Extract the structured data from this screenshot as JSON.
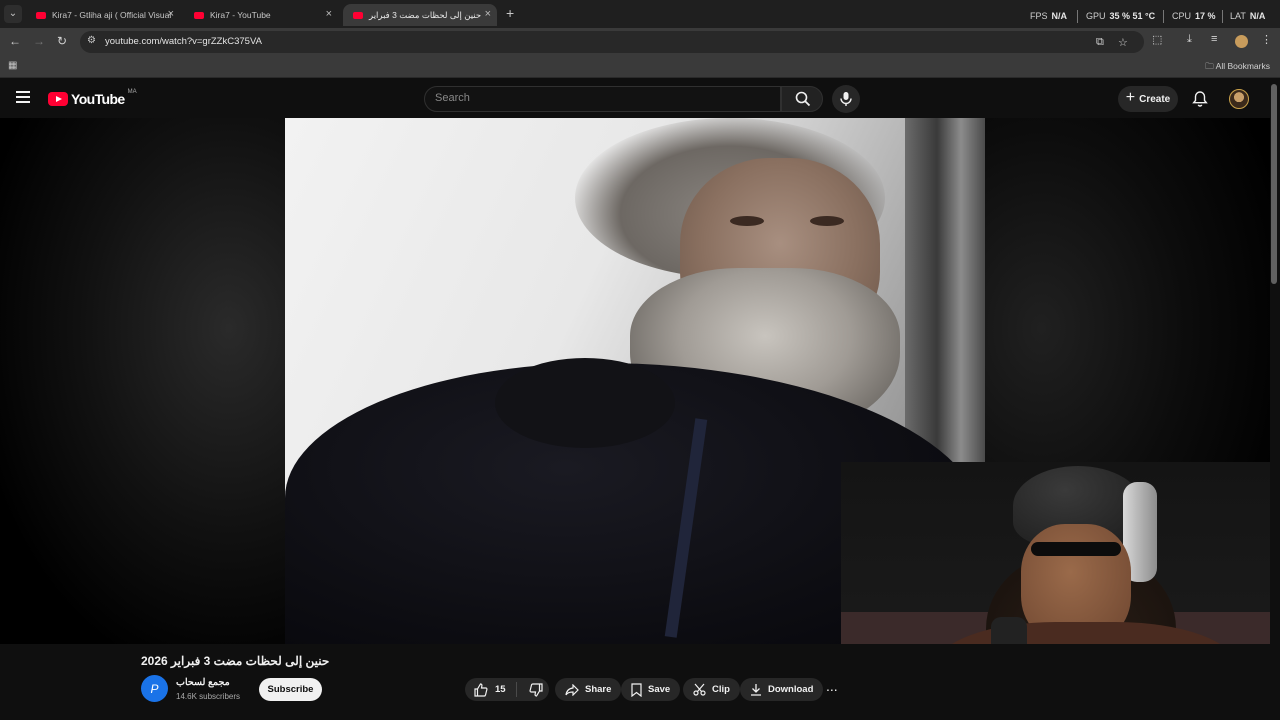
{
  "browser": {
    "tabs": [
      {
        "title": "Kira7 - Gtliha aji ( Official Visual",
        "active": false
      },
      {
        "title": "Kira7 - YouTube",
        "active": false
      },
      {
        "title": "حنين إلى لحظات مضت 3 فبراير",
        "active": true
      }
    ],
    "url": "youtube.com/watch?v=grZZkC375VA",
    "bookmarks_label": "All Bookmarks"
  },
  "overlay_stats": {
    "fps_label": "FPS",
    "fps_value": "N/A",
    "gpu_label": "GPU",
    "gpu_value": "35 % 51 °C",
    "cpu_label": "CPU",
    "cpu_value": "17 %",
    "lat_label": "LAT",
    "lat_value": "N/A"
  },
  "youtube": {
    "logo_text": "YouTube",
    "country_code": "MA",
    "search_placeholder": "Search",
    "create_label": "Create"
  },
  "video": {
    "title": "حنين إلى لحظات مضت 3 فبراير 2026",
    "channel_initial": "P",
    "channel_name": "مجمع لسحاب",
    "subscribers": "14.6K subscribers",
    "subscribe_label": "Subscribe",
    "likes": "15",
    "share_label": "Share",
    "save_label": "Save",
    "clip_label": "Clip",
    "download_label": "Download",
    "more_label": "..."
  },
  "colors": {
    "youtube_red": "#ff0033",
    "channel_avatar": "#1a73e8",
    "page_bg": "#0f0f0f"
  }
}
